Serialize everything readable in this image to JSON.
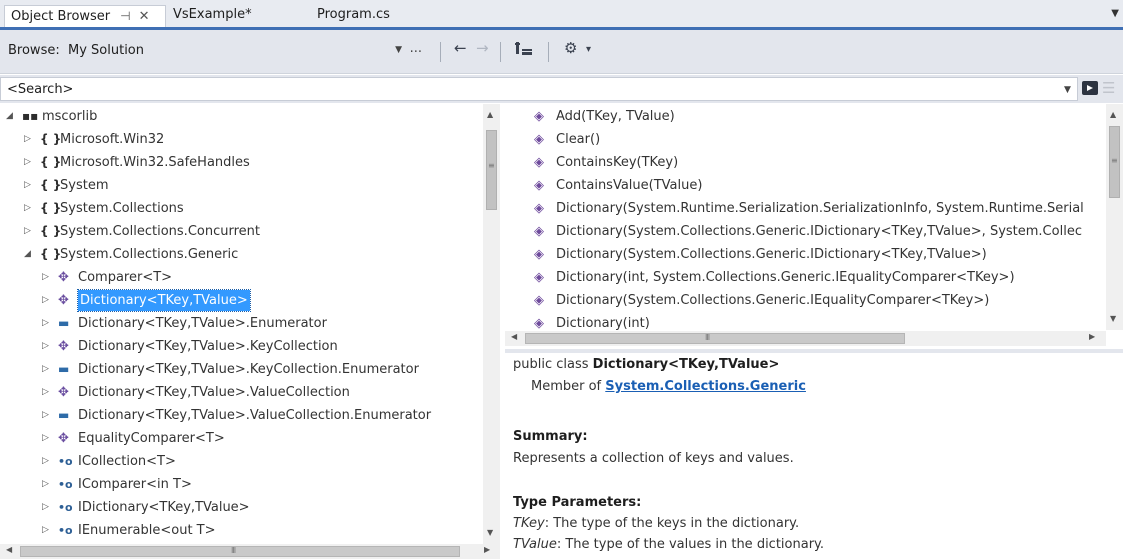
{
  "tabs": [
    {
      "label": "Object Browser",
      "active": true
    },
    {
      "label": "VsExample*",
      "active": false
    },
    {
      "label": "Program.cs",
      "active": false
    }
  ],
  "tab_icons": {
    "pin": "⊣",
    "close": "✕",
    "overflow": "▼"
  },
  "toolbar": {
    "browse_label": "Browse:",
    "browse_value": "My Solution",
    "more": "...",
    "back_icon": "←",
    "forward_icon": "→",
    "sort_icon": "sort-icon",
    "settings_icon": "gear-icon",
    "settings_glyph": "⚙",
    "settings_arrow": "▾"
  },
  "search": {
    "value": "<Search>"
  },
  "tree": [
    {
      "label": "mscorlib",
      "icon": "assembly-icon",
      "glyph": "▪▪",
      "expander": "◢",
      "level": 0
    },
    {
      "label": "Microsoft.Win32",
      "icon": "namespace-icon",
      "glyph": "{ }",
      "expander": "▷",
      "level": 1
    },
    {
      "label": "Microsoft.Win32.SafeHandles",
      "icon": "namespace-icon",
      "glyph": "{ }",
      "expander": "▷",
      "level": 1
    },
    {
      "label": "System",
      "icon": "namespace-icon",
      "glyph": "{ }",
      "expander": "▷",
      "level": 1
    },
    {
      "label": "System.Collections",
      "icon": "namespace-icon",
      "glyph": "{ }",
      "expander": "▷",
      "level": 1
    },
    {
      "label": "System.Collections.Concurrent",
      "icon": "namespace-icon",
      "glyph": "{ }",
      "expander": "▷",
      "level": 1
    },
    {
      "label": "System.Collections.Generic",
      "icon": "namespace-icon",
      "glyph": "{ }",
      "expander": "◢",
      "level": 1
    },
    {
      "label": "Comparer<T>",
      "icon": "class-icon",
      "glyph": "✥",
      "expander": "▷",
      "level": 2
    },
    {
      "label": "Dictionary<TKey,TValue>",
      "icon": "class-icon",
      "glyph": "✥",
      "expander": "▷",
      "level": 2,
      "selected": true
    },
    {
      "label": "Dictionary<TKey,TValue>.Enumerator",
      "icon": "struct-icon",
      "glyph": "▬",
      "expander": "▷",
      "level": 2
    },
    {
      "label": "Dictionary<TKey,TValue>.KeyCollection",
      "icon": "class-icon",
      "glyph": "✥",
      "expander": "▷",
      "level": 2
    },
    {
      "label": "Dictionary<TKey,TValue>.KeyCollection.Enumerator",
      "icon": "struct-icon",
      "glyph": "▬",
      "expander": "▷",
      "level": 2
    },
    {
      "label": "Dictionary<TKey,TValue>.ValueCollection",
      "icon": "class-icon",
      "glyph": "✥",
      "expander": "▷",
      "level": 2
    },
    {
      "label": "Dictionary<TKey,TValue>.ValueCollection.Enumerator",
      "icon": "struct-icon",
      "glyph": "▬",
      "expander": "▷",
      "level": 2
    },
    {
      "label": "EqualityComparer<T>",
      "icon": "class-icon",
      "glyph": "✥",
      "expander": "▷",
      "level": 2
    },
    {
      "label": "ICollection<T>",
      "icon": "interface-icon",
      "glyph": "•o",
      "expander": "▷",
      "level": 2
    },
    {
      "label": "IComparer<in T>",
      "icon": "interface-icon",
      "glyph": "•o",
      "expander": "▷",
      "level": 2
    },
    {
      "label": "IDictionary<TKey,TValue>",
      "icon": "interface-icon",
      "glyph": "•o",
      "expander": "▷",
      "level": 2
    },
    {
      "label": "IEnumerable<out T>",
      "icon": "interface-icon",
      "glyph": "•o",
      "expander": "▷",
      "level": 2
    }
  ],
  "members": [
    {
      "label": "Add(TKey, TValue)",
      "icon": "method-icon",
      "glyph": "◈"
    },
    {
      "label": "Clear()",
      "icon": "method-icon",
      "glyph": "◈"
    },
    {
      "label": "ContainsKey(TKey)",
      "icon": "method-icon",
      "glyph": "◈"
    },
    {
      "label": "ContainsValue(TValue)",
      "icon": "method-icon",
      "glyph": "◈"
    },
    {
      "label": "Dictionary(System.Runtime.Serialization.SerializationInfo, System.Runtime.Serial",
      "icon": "protected-method-icon",
      "glyph": "◈"
    },
    {
      "label": "Dictionary(System.Collections.Generic.IDictionary<TKey,TValue>, System.Collec",
      "icon": "method-icon",
      "glyph": "◈"
    },
    {
      "label": "Dictionary(System.Collections.Generic.IDictionary<TKey,TValue>)",
      "icon": "method-icon",
      "glyph": "◈"
    },
    {
      "label": "Dictionary(int, System.Collections.Generic.IEqualityComparer<TKey>)",
      "icon": "method-icon",
      "glyph": "◈"
    },
    {
      "label": "Dictionary(System.Collections.Generic.IEqualityComparer<TKey>)",
      "icon": "method-icon",
      "glyph": "◈"
    },
    {
      "label": "Dictionary(int)",
      "icon": "method-icon",
      "glyph": "◈"
    }
  ],
  "scroll_icons": {
    "up": "▲",
    "down": "▼",
    "left": "◀",
    "right": "▶",
    "grip": "III",
    "vgrip": "≡"
  },
  "description": {
    "signature_prefix": "public class ",
    "signature_name": "Dictionary<TKey,TValue>",
    "member_of_prefix": "Member of ",
    "member_of_link": "System.Collections.Generic",
    "summary_heading": "Summary:",
    "summary_text": "Represents a collection of keys and values.",
    "type_params_heading": "Type Parameters:",
    "params": [
      {
        "name": "TKey",
        "text": ": The type of the keys in the dictionary."
      },
      {
        "name": "TValue",
        "text": ": The type of the values in the dictionary."
      }
    ]
  }
}
